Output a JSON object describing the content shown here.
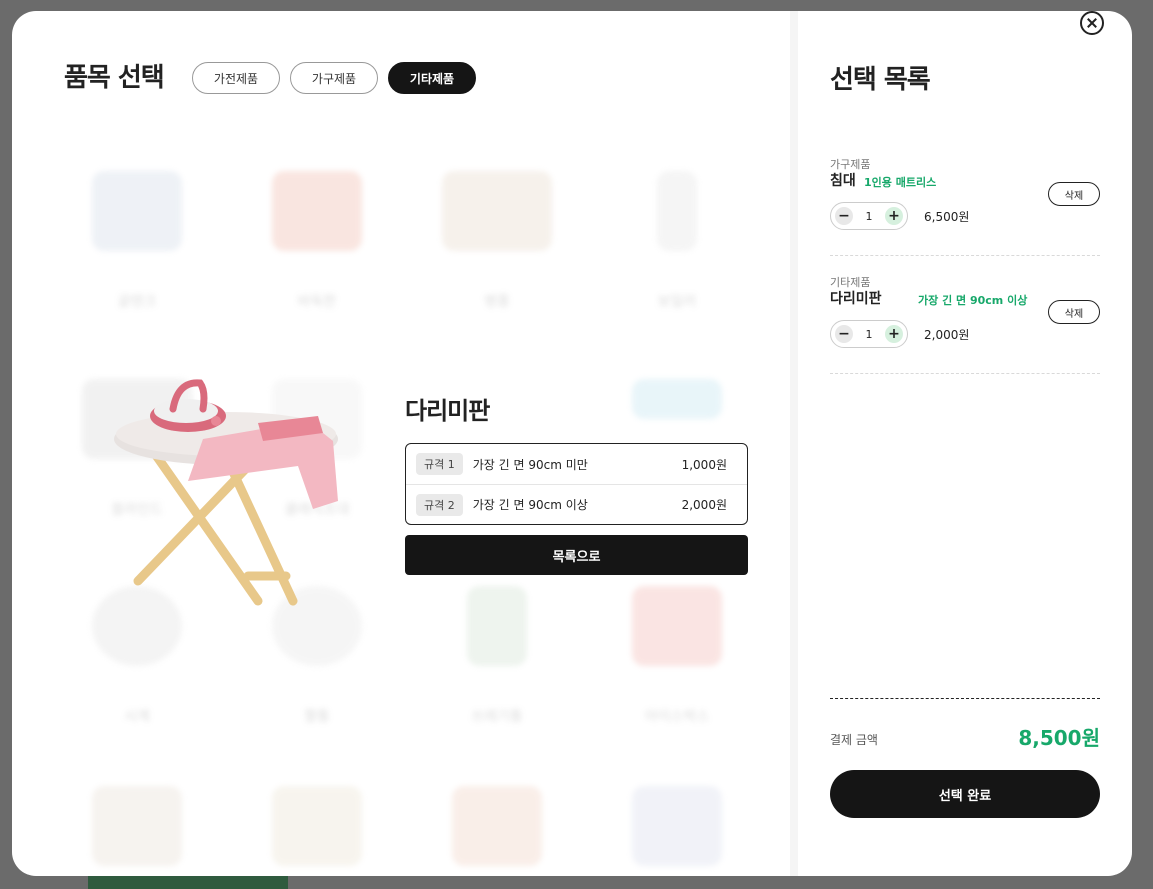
{
  "left": {
    "title": "품목 선택",
    "tabs": [
      {
        "label": "가전제품",
        "active": false
      },
      {
        "label": "가구제품",
        "active": false
      },
      {
        "label": "기타제품",
        "active": true
      }
    ],
    "grid_items": [
      "골텐크",
      "바둑판",
      "병풍",
      "보일러",
      "블라인드",
      "클래식조대",
      "시계",
      "짤통",
      "쓰레기통",
      "아이스박스"
    ]
  },
  "detail": {
    "name": "다리미판",
    "image_icon": "ironing-board-image",
    "specs": [
      {
        "badge": "규격 1",
        "desc": "가장 긴 면 90cm 미만",
        "price": "1,000원"
      },
      {
        "badge": "규격 2",
        "desc": "가장 긴 면 90cm 이상",
        "price": "2,000원"
      }
    ],
    "back_label": "목록으로"
  },
  "selection": {
    "title": "선택 목록",
    "items": [
      {
        "category": "가구제품",
        "name": "침대",
        "spec": "1인용 매트리스",
        "qty": "1",
        "price": "6,500원",
        "delete_label": "삭제"
      },
      {
        "category": "기타제품",
        "name": "다리미판",
        "spec": "가장 긴 면 90cm 이상",
        "qty": "1",
        "price": "2,000원",
        "delete_label": "삭제"
      }
    ],
    "total_label": "결제 금액",
    "total_value": "8,500원",
    "done_label": "선택 완료"
  },
  "colors": {
    "accent_green": "#17a86a",
    "dark": "#151515"
  }
}
